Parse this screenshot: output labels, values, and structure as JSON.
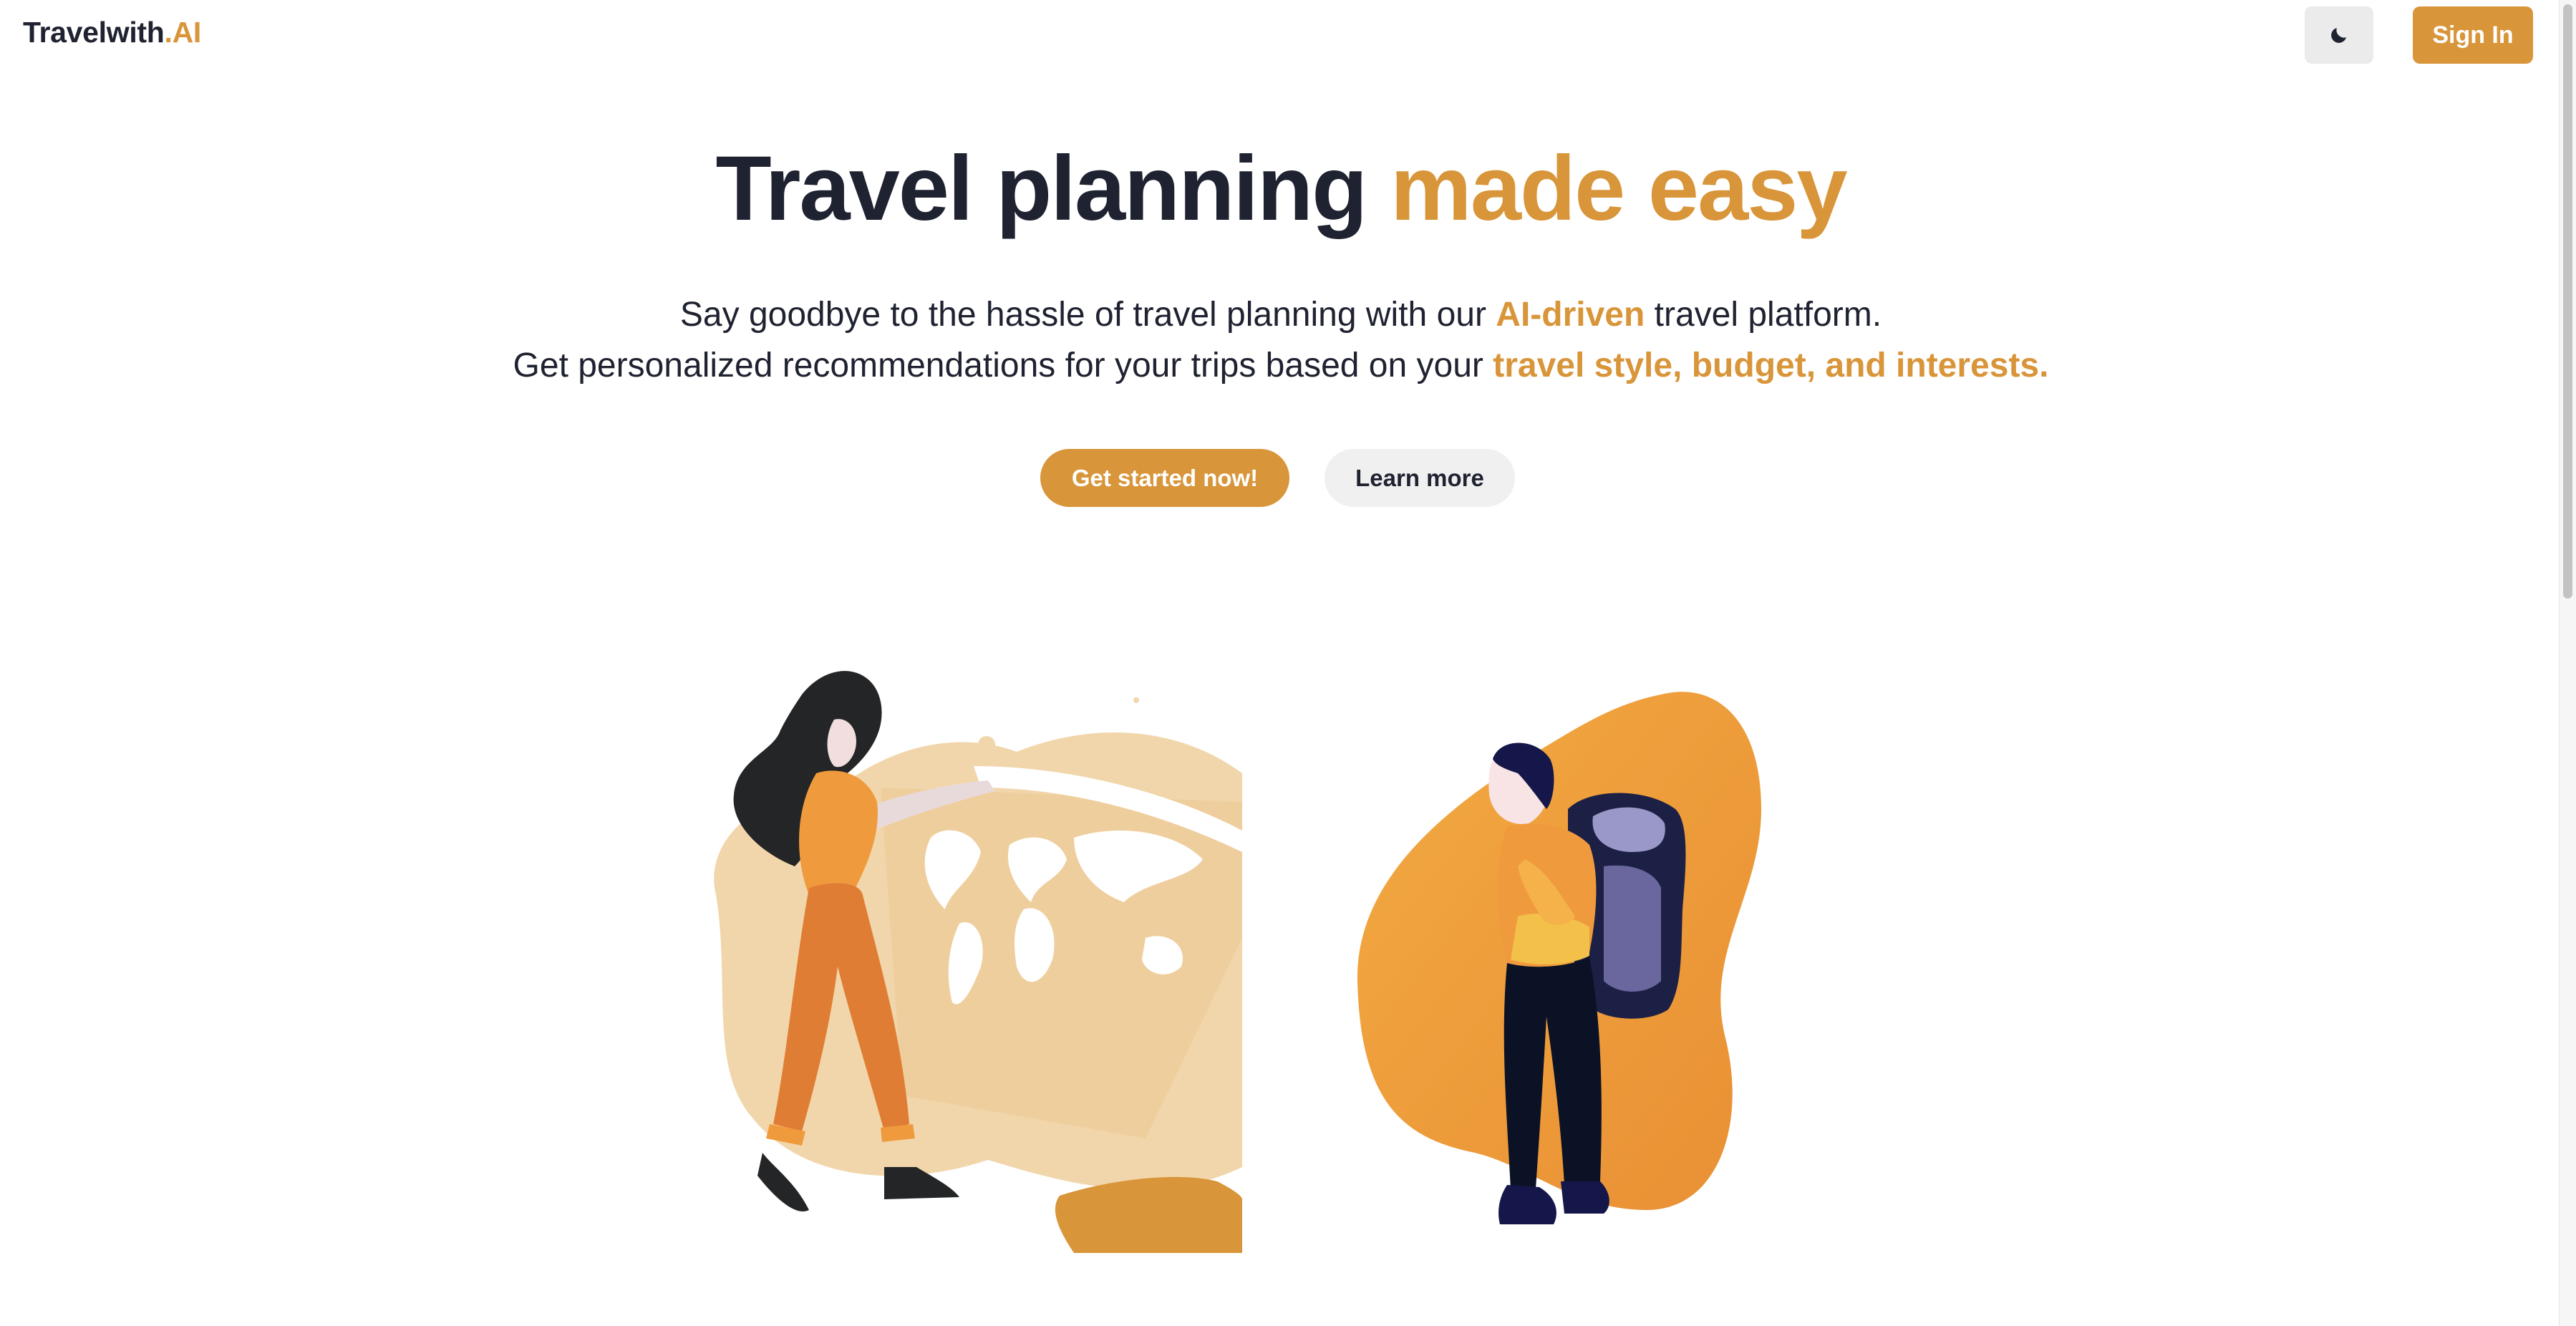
{
  "header": {
    "brand_main": "Travelwith",
    "brand_accent": ".AI",
    "theme_toggle_icon": "moon-icon",
    "sign_in_label": "Sign In"
  },
  "hero": {
    "title_main": "Travel planning ",
    "title_accent": "made easy",
    "line1_pre": "Say goodbye to the hassle of travel planning with our ",
    "line1_highlight": "AI-driven",
    "line1_post": " travel platform.",
    "line2_pre": "Get personalized recommendations for your trips based on your ",
    "line2_highlight": "travel style, budget, and interests.",
    "primary_cta": "Get started now!",
    "secondary_cta": "Learn more"
  },
  "colors": {
    "accent": "#d89539",
    "text": "#1f2230",
    "button_secondary_bg": "#f0f0f0",
    "theme_button_bg": "#ebebeb"
  },
  "illustrations": {
    "left": "woman-with-world-map-illustration",
    "right": "backpacker-illustration"
  }
}
